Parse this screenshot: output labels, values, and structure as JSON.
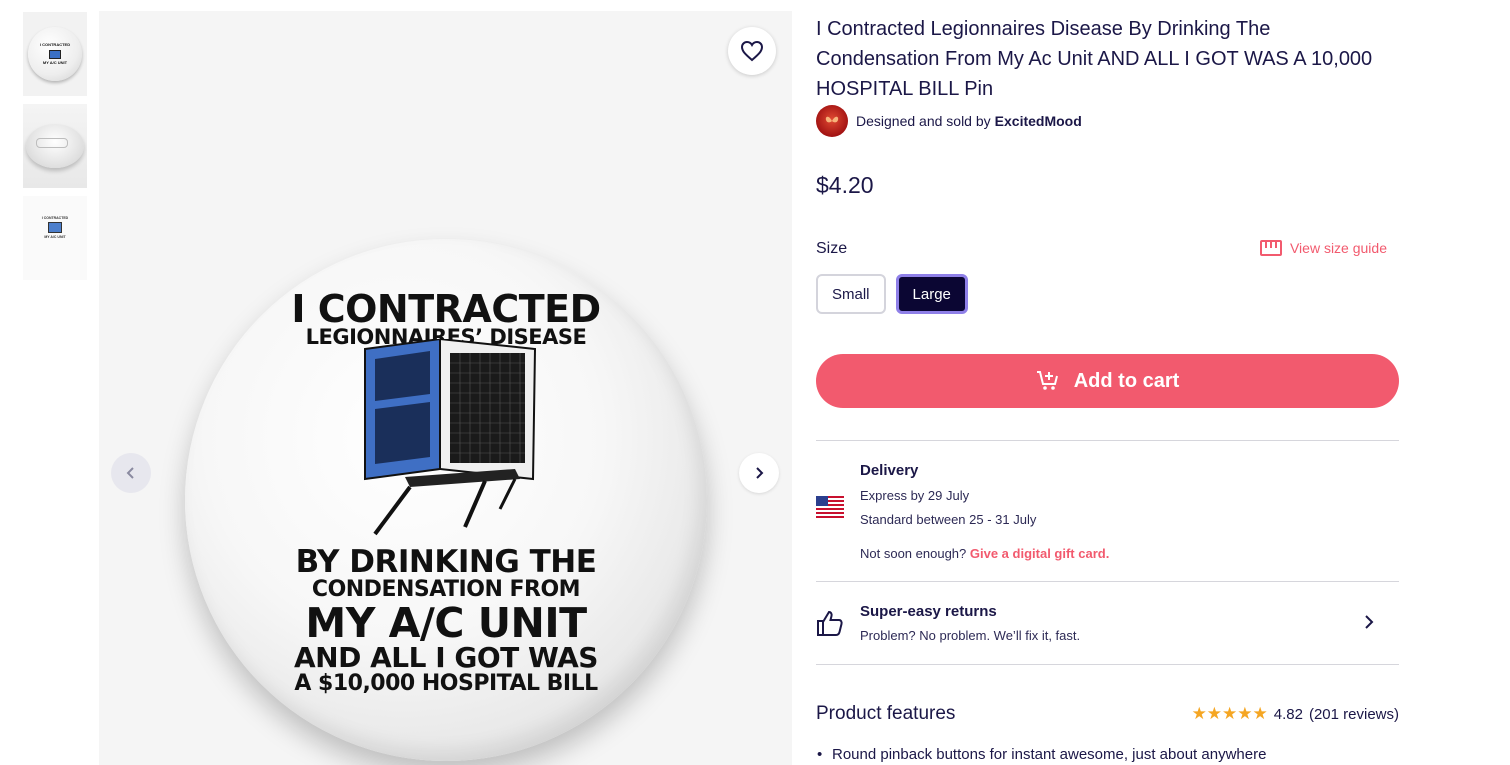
{
  "thumbnails": [
    "front-view",
    "back-view",
    "artwork-view"
  ],
  "thumbnail_mini_text": {
    "t1_top": "I CONTRACTED",
    "t1_bottom": "MY A/C UNIT"
  },
  "pin_art": {
    "line1": "I CONTRACTED",
    "line2": "LEGIONNAIRES’ DISEASE",
    "line3": "BY DRINKING THE",
    "line4": "CONDENSATION FROM",
    "line5": "MY A/C UNIT",
    "line6": "AND ALL I GOT WAS",
    "line7": "A $10,000 HOSPITAL BILL"
  },
  "product": {
    "title": "I Contracted Legionnaires Disease By Drinking The Condensation From My Ac Unit AND ALL I GOT WAS A 10,000 HOSPITAL BILL Pin",
    "seller_prefix": "Designed and sold by",
    "seller_name": "ExcitedMood",
    "price": "$4.20"
  },
  "size": {
    "label": "Size",
    "guide_label": "View size guide",
    "options": [
      "Small",
      "Large"
    ],
    "selected": "Large"
  },
  "cart": {
    "label": "Add to cart"
  },
  "delivery": {
    "title": "Delivery",
    "express": "Express by 29 July",
    "standard": "Standard between 25 - 31 July",
    "not_soon": "Not soon enough?",
    "gift_link": "Give a digital gift card."
  },
  "returns": {
    "title": "Super-easy returns",
    "subtitle": "Problem? No problem. We’ll fix it, fast."
  },
  "features": {
    "title": "Product features",
    "rating": "4.82",
    "reviews": "(201 reviews)",
    "stars": "★★★★★",
    "bullets": [
      "Round pinback buttons for instant awesome, just about anywhere"
    ]
  },
  "colors": {
    "accent": "#f25a6e",
    "navy": "#0b0633",
    "selected_border": "#8f80e8",
    "star": "#f5a623"
  },
  "icons": [
    "heart-icon",
    "chevron-left-icon",
    "chevron-right-icon",
    "ruler-icon",
    "cart-plus-icon",
    "us-flag-icon",
    "thumbs-up-icon"
  ]
}
